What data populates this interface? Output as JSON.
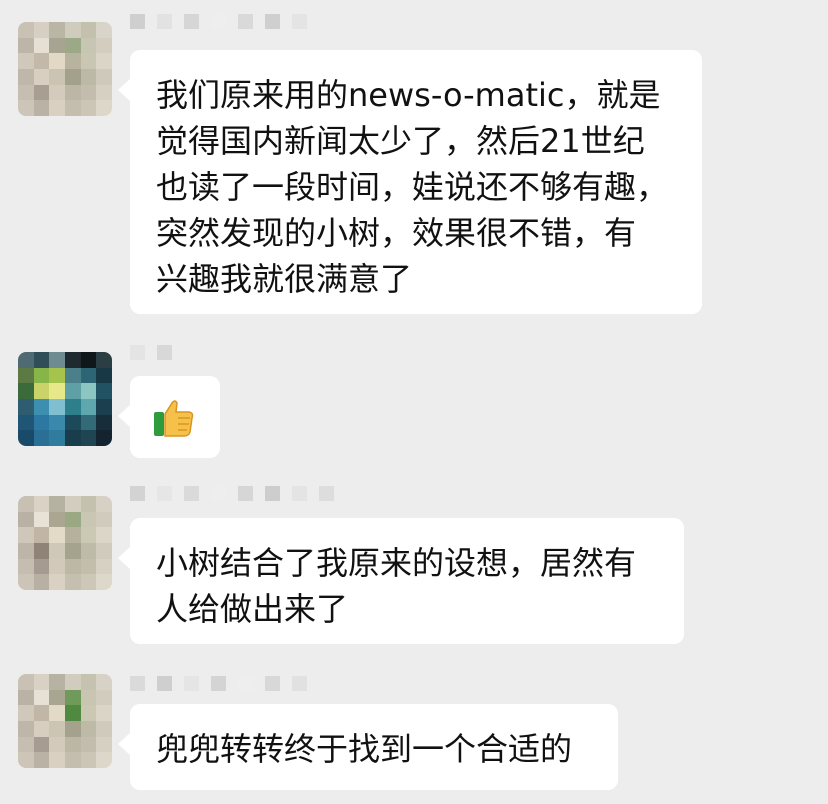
{
  "messages": [
    {
      "lines": [
        "我们原来用的news-o-matic，就是",
        "觉得国内新闻太少了，然后21世纪",
        "也读了一段时间，娃说还不够有趣，",
        "突然发现的小树，效果很不错，有",
        "兴趣我就很满意了"
      ]
    },
    {
      "emoji": "thumbs-up-icon"
    },
    {
      "lines": [
        "小树结合了我原来的设想，居然有",
        "人给做出来了"
      ]
    },
    {
      "lines": [
        "兜兜转转终于找到一个合适的"
      ]
    }
  ],
  "colors": {
    "background": "#ededed",
    "bubble": "#ffffff",
    "text": "#111111"
  }
}
